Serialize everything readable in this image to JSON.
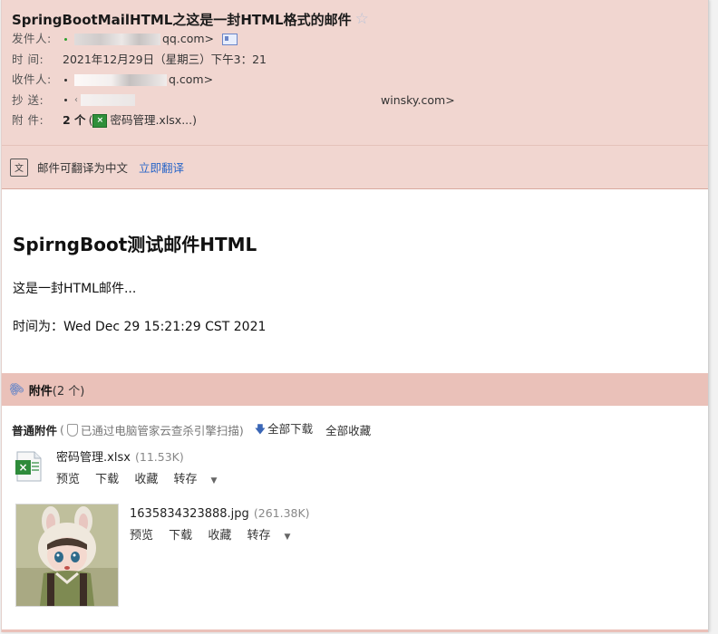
{
  "subject": "SpringBootMailHTML之这是一封HTML格式的邮件",
  "meta": {
    "from_label": "发件人:",
    "from_value": "qq.com>",
    "time_label": "时  间:",
    "time_value": "2021年12月29日（星期三）下午3：21",
    "to_label": "收件人:",
    "to_value": "q.com>",
    "cc_label": "抄  送:",
    "cc_value": "winsky.com>",
    "attach_label": "附  件:",
    "attach_count": "2 个",
    "attach_paren_open": "(",
    "attach_file": "密码管理.xlsx...)"
  },
  "translate": {
    "text": "邮件可翻译为中文",
    "link": "立即翻译"
  },
  "body": {
    "title": "SpirngBoot测试邮件HTML",
    "line1": "这是一封HTML邮件...",
    "line2": "时间为：Wed Dec 29 15:21:29 CST 2021"
  },
  "attachments": {
    "header_label": "附件",
    "header_count": "(2 个)",
    "normal_label": "普通附件",
    "scan_open": "(",
    "scan_text": "已通过电脑管家云查杀引擎扫描)",
    "download_all": "全部下载",
    "favorite_all": "全部收藏",
    "files": [
      {
        "name": "密码管理.xlsx",
        "size": "(11.53K)"
      },
      {
        "name": "1635834323888.jpg",
        "size": "(261.38K)"
      }
    ],
    "actions": {
      "preview": "预览",
      "download": "下载",
      "favorite": "收藏",
      "forward": "转存"
    }
  },
  "colors": {
    "header_bg": "#f1d6d0",
    "attach_bg": "#eac1b9",
    "link": "#2b67c8"
  }
}
